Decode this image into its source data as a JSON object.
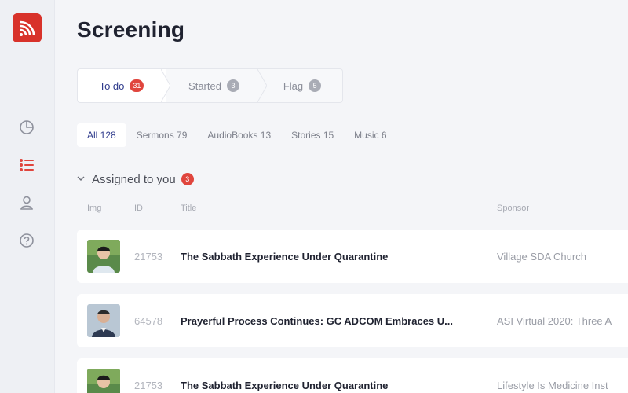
{
  "page": {
    "title": "Screening"
  },
  "sidebar": {
    "logo_icon": "broadcast-logo",
    "items": [
      {
        "name": "dashboard",
        "icon": "pie-chart-icon"
      },
      {
        "name": "list",
        "icon": "list-icon",
        "active": true
      },
      {
        "name": "profile",
        "icon": "user-icon"
      },
      {
        "name": "help",
        "icon": "help-icon"
      }
    ]
  },
  "stage_tabs": [
    {
      "label": "To do",
      "count": "31",
      "active": true
    },
    {
      "label": "Started",
      "count": "3"
    },
    {
      "label": "Flag",
      "count": "5"
    }
  ],
  "category_tabs": [
    {
      "label": "All 128",
      "active": true
    },
    {
      "label": "Sermons 79"
    },
    {
      "label": "AudioBooks 13"
    },
    {
      "label": "Stories 15"
    },
    {
      "label": "Music 6"
    }
  ],
  "section": {
    "title": "Assigned to you",
    "count": "3"
  },
  "columns": {
    "img": "Img",
    "id": "ID",
    "title": "Title",
    "sponsor": "Sponsor"
  },
  "rows": [
    {
      "id": "21753",
      "title": "The Sabbath Experience Under Quarantine",
      "sponsor": "Village SDA Church"
    },
    {
      "id": "64578",
      "title": "Prayerful Process Continues: GC ADCOM Embraces U...",
      "sponsor": "ASI Virtual 2020: Three A"
    },
    {
      "id": "21753",
      "title": "The Sabbath Experience Under Quarantine",
      "sponsor": "Lifestyle Is Medicine Inst"
    }
  ],
  "colors": {
    "accent": "#2f3b8c",
    "brand": "#d8322a",
    "badge": "#e0453d"
  }
}
